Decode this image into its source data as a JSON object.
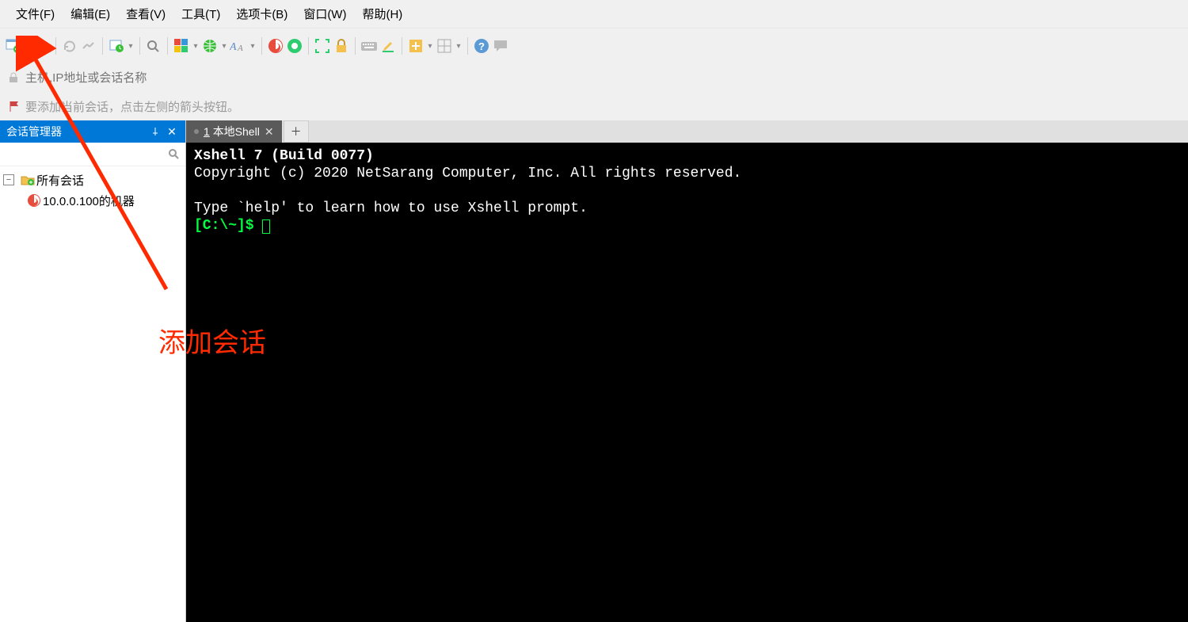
{
  "menu": {
    "file": "文件(F)",
    "edit": "编辑(E)",
    "view": "查看(V)",
    "tools": "工具(T)",
    "tabs": "选项卡(B)",
    "window": "窗口(W)",
    "help": "帮助(H)"
  },
  "toolbar_icons": [
    "new-session",
    "open-folder",
    "reconnect",
    "link",
    "properties",
    "find",
    "color-grid",
    "globe",
    "font",
    "xftp-transfer",
    "xagent",
    "fullscreen",
    "lock",
    "keyboard",
    "highlighter",
    "add-pane",
    "layout",
    "help",
    "chat"
  ],
  "addressbar": {
    "placeholder": "主机,IP地址或会话名称"
  },
  "hint": {
    "text": "要添加当前会话，点击左侧的箭头按钮。"
  },
  "sidebar": {
    "title": "会话管理器",
    "search_placeholder": "",
    "root": "所有会话",
    "items": [
      "10.0.0.100的机器"
    ]
  },
  "tab": {
    "index": "1",
    "label": "本地Shell"
  },
  "terminal": {
    "line1": "Xshell 7 (Build 0077)",
    "line2": "Copyright (c) 2020 NetSarang Computer, Inc. All rights reserved.",
    "line3": "",
    "line4": "Type `help' to learn how to use Xshell prompt.",
    "prompt": "[C:\\~]$ "
  },
  "annotation": {
    "text": "添加会话"
  }
}
